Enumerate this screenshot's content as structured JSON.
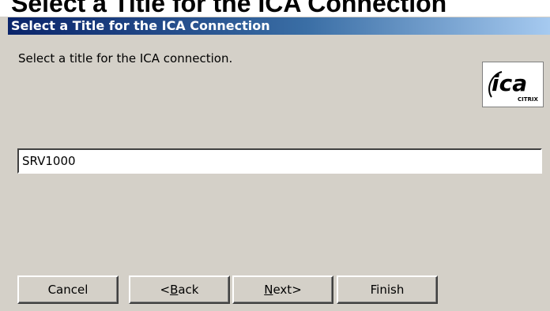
{
  "page_heading": "Select a Title for the ICA Connection",
  "dialog": {
    "title": "Select a Title for the ICA Connection",
    "instruction": "Select a title for the ICA connection.",
    "logo": {
      "text": "ica",
      "subtext": "CITRIX"
    },
    "title_input": {
      "value": "SRV1000"
    },
    "buttons": {
      "cancel": {
        "label": "Cancel"
      },
      "back": {
        "prefix": "<",
        "accelerator": "B",
        "rest": "ack"
      },
      "next": {
        "accelerator": "N",
        "rest": "ext>"
      },
      "finish": {
        "label": "Finish"
      }
    }
  },
  "colors": {
    "window_face": "#d4d0c8",
    "titlebar_start": "#0a246a",
    "titlebar_end": "#a6caf0",
    "titlebar_text": "#ffffff"
  }
}
